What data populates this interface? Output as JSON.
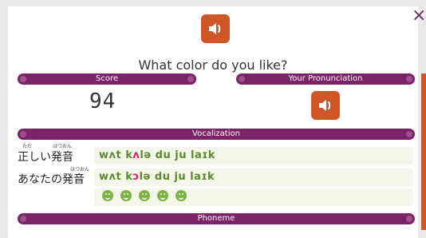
{
  "header": {
    "close_label": "×"
  },
  "question": {
    "title": "What color do you like?"
  },
  "bars": {
    "score": "Score",
    "your_pronunciation": "Your Pronunciation",
    "vocalization": "Vocalization",
    "phoneme": "Phoneme"
  },
  "score": {
    "value": "94"
  },
  "vocalization": {
    "correct_label": "正しい発音",
    "correct_ruby_1": "ただ",
    "correct_ruby_2": "はつおん",
    "yours_label": "あなたの発音",
    "yours_ruby": "はつおん",
    "correct_ipa": {
      "p1": "wʌt k",
      "p2": "ʌ",
      "p3": "lə du ju laɪk"
    },
    "yours_ipa": {
      "p1": "wʌt k",
      "p2": "ɔ",
      "p3": "lə du ju laɪk"
    },
    "word_ratings": [
      "good",
      "good",
      "good",
      "good",
      "good"
    ]
  },
  "colors": {
    "accent_orange": "#cf5626",
    "bar_purple": "#7b2367",
    "ipa_green": "#5b8a2e",
    "ipa_highlight": "#e0196e",
    "smile_green": "#7cb342"
  },
  "icons": {
    "play_audio": "speaker-icon",
    "play_user_audio": "speaker-icon",
    "rating": "smile-icon"
  }
}
